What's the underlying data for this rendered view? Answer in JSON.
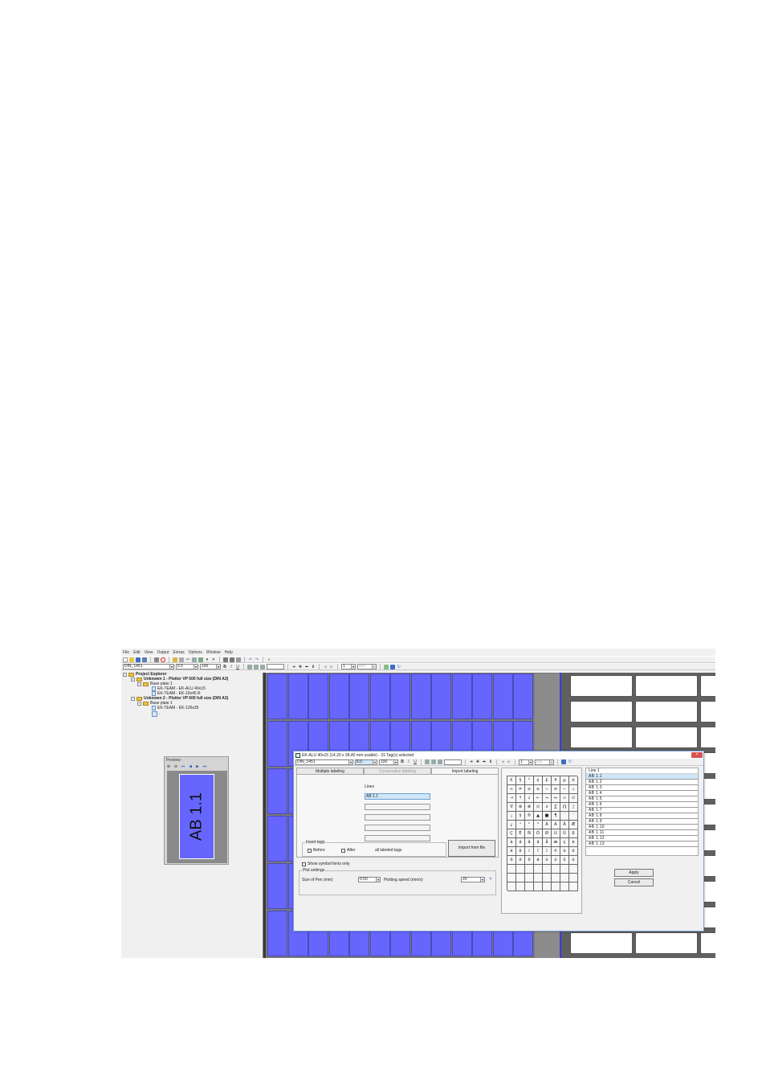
{
  "menu": [
    "File",
    "Edit",
    "View",
    "Output",
    "Extras",
    "Options",
    "Window",
    "Help"
  ],
  "toolbar2": {
    "font": "DIN_1451",
    "size": "6.5",
    "width": "100",
    "bold": "B",
    "italic": "I",
    "underline": "U",
    "spin_value": "1",
    "spin2_value": "0.0"
  },
  "tree": {
    "root": "Project Explorer",
    "enclosure1": "Unknown 1 - Plotter VP 500 full size (DIN A3)",
    "baseplate1": "Base plate 1",
    "item1": "EK-TEAM - EK-ALU 40x15",
    "item2": "EK-TEAM - EK-19x45 R",
    "enclosure2": "Unknown 2 - Plotter VP 600 full size (DIN A3)",
    "baseplate2": "Base plate 1",
    "item3": "EK-TEAM - EK-126x35",
    "item4": "-"
  },
  "preview": {
    "title": "Preview",
    "label_text": "AB 1.1",
    "label_color": "#6666ff"
  },
  "dialog": {
    "title": "EK-ALU 40x15 (14,20 x 38,40 mm usable) - 31 Tag(s) selected",
    "close": "×",
    "font": "DIN_1451",
    "size": "6.0",
    "width": "100",
    "spin_value": "1",
    "spin2_value": "0.0",
    "tabs": [
      "Multiple labeling",
      "Consecutive labeling",
      "Import labeling"
    ],
    "lines_label": "Lines",
    "line1": "AB 1.1",
    "insert_tags_legend": "Insert tags",
    "before": "Before",
    "after": "After",
    "all_labeled": "all labeled tags",
    "import_button": "Import from file",
    "show_symbol": "Show symbol fonts only",
    "plot_legend": "Plot settings",
    "pen_label": "Size of Pen (mm)",
    "pen_value": "0,50",
    "speed_label": "Plotting speed (mm/s)",
    "speed_value": "20",
    "apply": "Apply",
    "cancel": "Cancel",
    "list_header": "Line 1",
    "list_items": [
      "AB 1.1",
      "AB 1.2",
      "AB 1.3",
      "AB 1.4",
      "AB 1.5",
      "AB 1.6",
      "AB 1.7",
      "AB 1.8",
      "AB 1.9",
      "AB 1.10",
      "AB 1.11",
      "AB 1.12",
      "AB 1.13"
    ],
    "chars": [
      "€",
      "§",
      "°",
      "¢",
      "£",
      "¥",
      "µ",
      "±",
      "≈",
      "≠",
      "≤",
      "≥",
      "−",
      "≡",
      "∼",
      "⊥",
      "→",
      "↑",
      "↓",
      "←",
      "⇒",
      "⇔",
      "∞",
      "∅",
      "∇",
      "⊕",
      "⊗",
      "⊙",
      "∂",
      "∑",
      "∏",
      "∫",
      "¡",
      "§",
      "©",
      "▲",
      "■",
      "¶",
      "´",
      "¨",
      "¿",
      "¹",
      "²",
      "³",
      "À",
      "Á",
      "Â",
      "Æ",
      "Ç",
      "È",
      "Ñ",
      "Ò",
      "Ø",
      "Ù",
      "Ü",
      "ß",
      "à",
      "á",
      "â",
      "ä",
      "å",
      "æ",
      "ç",
      "è",
      "é",
      "ê",
      "í",
      "î",
      "ï",
      "ñ",
      "ò",
      "ó",
      "ô",
      "õ",
      "ö",
      "ø",
      "ù",
      "ú",
      "û",
      "ü"
    ]
  },
  "colors": {
    "label_blue": "#6666ff",
    "canvas_grey": "#7a7a7a",
    "selection": "#cfe6f7"
  }
}
